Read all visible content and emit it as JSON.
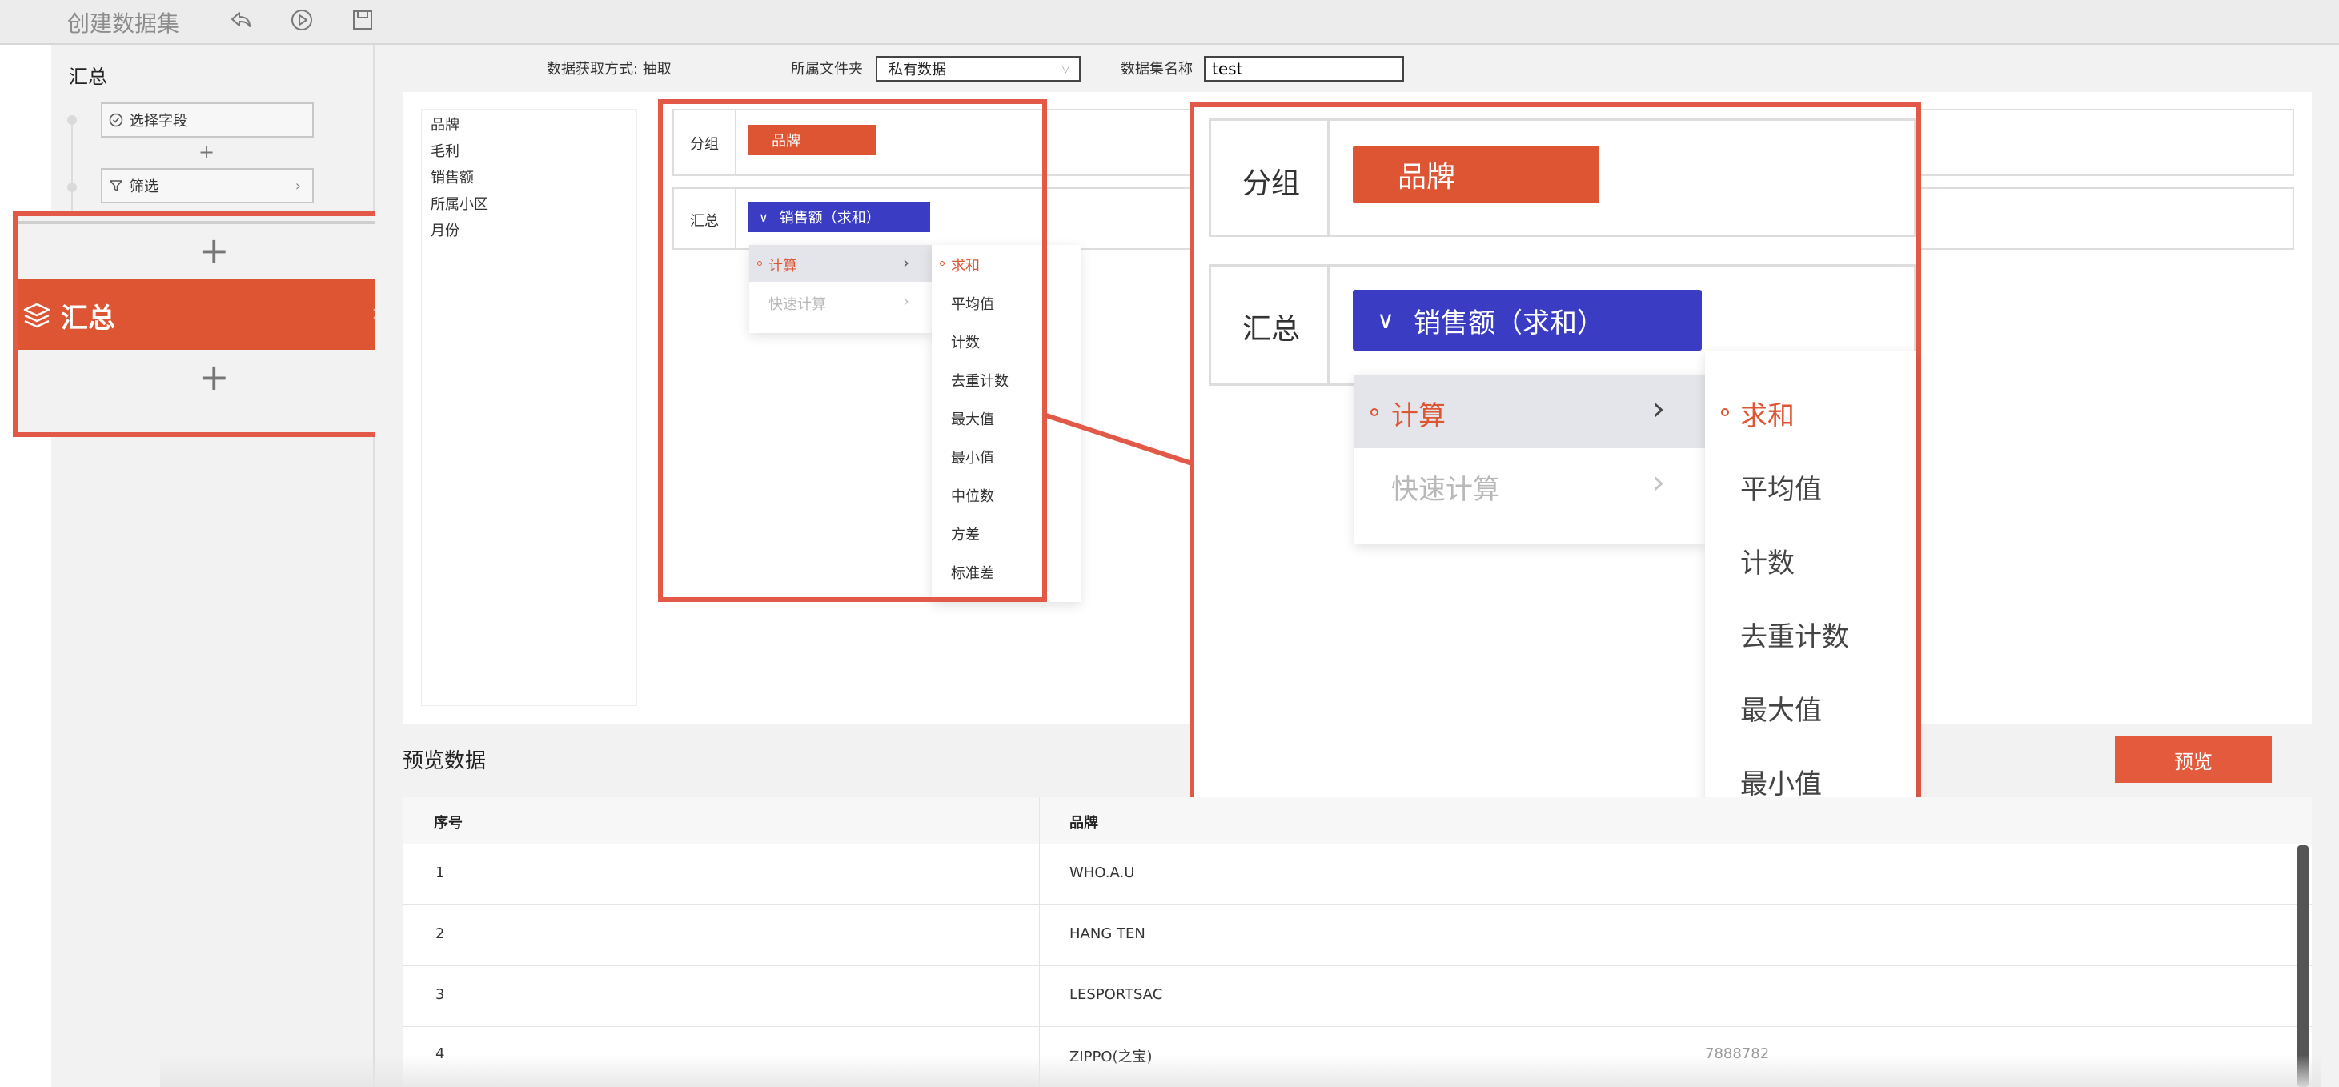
{
  "app": {
    "title": "创建数据集"
  },
  "sidebar": {
    "title": "汇总",
    "steps": [
      {
        "label": "选择字段"
      },
      {
        "label": "筛选"
      }
    ],
    "active_step": "汇总"
  },
  "config": {
    "fetch_label": "数据获取方式:",
    "fetch_value": "抽取",
    "folder_label": "所属文件夹",
    "folder_value": "私有数据",
    "name_label": "数据集名称",
    "name_value": "test"
  },
  "fields": [
    "品牌",
    "毛利",
    "销售额",
    "所属小区",
    "月份"
  ],
  "group": {
    "label": "分组",
    "chip": "品牌"
  },
  "summary": {
    "label": "汇总",
    "chip": "销售额（求和）"
  },
  "menu_left": [
    {
      "label": "计算",
      "state": "active"
    },
    {
      "label": "快速计算",
      "state": "disabled"
    }
  ],
  "menu_right": [
    {
      "label": "求和",
      "selected": true
    },
    {
      "label": "平均值"
    },
    {
      "label": "计数"
    },
    {
      "label": "去重计数"
    },
    {
      "label": "最大值"
    },
    {
      "label": "最小值"
    },
    {
      "label": "中位数"
    },
    {
      "label": "方差"
    },
    {
      "label": "标准差"
    }
  ],
  "preview": {
    "title": "预览数据",
    "button": "预览",
    "columns": [
      "序号",
      "品牌"
    ],
    "rows": [
      [
        "1",
        "WHO.A.U"
      ],
      [
        "2",
        "HANG TEN"
      ],
      [
        "3",
        "LESPORTSAC"
      ],
      [
        "4",
        "ZIPPO(之宝)"
      ]
    ],
    "partial_cell": "7888782"
  },
  "colors": {
    "accent_orange": "#dd5533",
    "accent_blue": "#3a3dc4",
    "callout_red": "#e35948"
  },
  "icons": [
    "undo-icon",
    "play-icon",
    "save-icon",
    "check-circle-icon",
    "filter-icon",
    "layers-icon",
    "chevron-right-icon",
    "chevron-down-icon",
    "plus-icon"
  ]
}
